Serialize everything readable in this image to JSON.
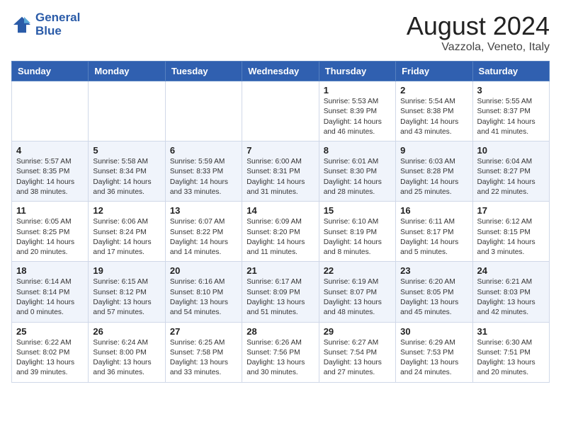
{
  "header": {
    "logo_line1": "General",
    "logo_line2": "Blue",
    "month_year": "August 2024",
    "location": "Vazzola, Veneto, Italy"
  },
  "weekdays": [
    "Sunday",
    "Monday",
    "Tuesday",
    "Wednesday",
    "Thursday",
    "Friday",
    "Saturday"
  ],
  "weeks": [
    [
      {
        "day": "",
        "info": ""
      },
      {
        "day": "",
        "info": ""
      },
      {
        "day": "",
        "info": ""
      },
      {
        "day": "",
        "info": ""
      },
      {
        "day": "1",
        "info": "Sunrise: 5:53 AM\nSunset: 8:39 PM\nDaylight: 14 hours\nand 46 minutes."
      },
      {
        "day": "2",
        "info": "Sunrise: 5:54 AM\nSunset: 8:38 PM\nDaylight: 14 hours\nand 43 minutes."
      },
      {
        "day": "3",
        "info": "Sunrise: 5:55 AM\nSunset: 8:37 PM\nDaylight: 14 hours\nand 41 minutes."
      }
    ],
    [
      {
        "day": "4",
        "info": "Sunrise: 5:57 AM\nSunset: 8:35 PM\nDaylight: 14 hours\nand 38 minutes."
      },
      {
        "day": "5",
        "info": "Sunrise: 5:58 AM\nSunset: 8:34 PM\nDaylight: 14 hours\nand 36 minutes."
      },
      {
        "day": "6",
        "info": "Sunrise: 5:59 AM\nSunset: 8:33 PM\nDaylight: 14 hours\nand 33 minutes."
      },
      {
        "day": "7",
        "info": "Sunrise: 6:00 AM\nSunset: 8:31 PM\nDaylight: 14 hours\nand 31 minutes."
      },
      {
        "day": "8",
        "info": "Sunrise: 6:01 AM\nSunset: 8:30 PM\nDaylight: 14 hours\nand 28 minutes."
      },
      {
        "day": "9",
        "info": "Sunrise: 6:03 AM\nSunset: 8:28 PM\nDaylight: 14 hours\nand 25 minutes."
      },
      {
        "day": "10",
        "info": "Sunrise: 6:04 AM\nSunset: 8:27 PM\nDaylight: 14 hours\nand 22 minutes."
      }
    ],
    [
      {
        "day": "11",
        "info": "Sunrise: 6:05 AM\nSunset: 8:25 PM\nDaylight: 14 hours\nand 20 minutes."
      },
      {
        "day": "12",
        "info": "Sunrise: 6:06 AM\nSunset: 8:24 PM\nDaylight: 14 hours\nand 17 minutes."
      },
      {
        "day": "13",
        "info": "Sunrise: 6:07 AM\nSunset: 8:22 PM\nDaylight: 14 hours\nand 14 minutes."
      },
      {
        "day": "14",
        "info": "Sunrise: 6:09 AM\nSunset: 8:20 PM\nDaylight: 14 hours\nand 11 minutes."
      },
      {
        "day": "15",
        "info": "Sunrise: 6:10 AM\nSunset: 8:19 PM\nDaylight: 14 hours\nand 8 minutes."
      },
      {
        "day": "16",
        "info": "Sunrise: 6:11 AM\nSunset: 8:17 PM\nDaylight: 14 hours\nand 5 minutes."
      },
      {
        "day": "17",
        "info": "Sunrise: 6:12 AM\nSunset: 8:15 PM\nDaylight: 14 hours\nand 3 minutes."
      }
    ],
    [
      {
        "day": "18",
        "info": "Sunrise: 6:14 AM\nSunset: 8:14 PM\nDaylight: 14 hours\nand 0 minutes."
      },
      {
        "day": "19",
        "info": "Sunrise: 6:15 AM\nSunset: 8:12 PM\nDaylight: 13 hours\nand 57 minutes."
      },
      {
        "day": "20",
        "info": "Sunrise: 6:16 AM\nSunset: 8:10 PM\nDaylight: 13 hours\nand 54 minutes."
      },
      {
        "day": "21",
        "info": "Sunrise: 6:17 AM\nSunset: 8:09 PM\nDaylight: 13 hours\nand 51 minutes."
      },
      {
        "day": "22",
        "info": "Sunrise: 6:19 AM\nSunset: 8:07 PM\nDaylight: 13 hours\nand 48 minutes."
      },
      {
        "day": "23",
        "info": "Sunrise: 6:20 AM\nSunset: 8:05 PM\nDaylight: 13 hours\nand 45 minutes."
      },
      {
        "day": "24",
        "info": "Sunrise: 6:21 AM\nSunset: 8:03 PM\nDaylight: 13 hours\nand 42 minutes."
      }
    ],
    [
      {
        "day": "25",
        "info": "Sunrise: 6:22 AM\nSunset: 8:02 PM\nDaylight: 13 hours\nand 39 minutes."
      },
      {
        "day": "26",
        "info": "Sunrise: 6:24 AM\nSunset: 8:00 PM\nDaylight: 13 hours\nand 36 minutes."
      },
      {
        "day": "27",
        "info": "Sunrise: 6:25 AM\nSunset: 7:58 PM\nDaylight: 13 hours\nand 33 minutes."
      },
      {
        "day": "28",
        "info": "Sunrise: 6:26 AM\nSunset: 7:56 PM\nDaylight: 13 hours\nand 30 minutes."
      },
      {
        "day": "29",
        "info": "Sunrise: 6:27 AM\nSunset: 7:54 PM\nDaylight: 13 hours\nand 27 minutes."
      },
      {
        "day": "30",
        "info": "Sunrise: 6:29 AM\nSunset: 7:53 PM\nDaylight: 13 hours\nand 24 minutes."
      },
      {
        "day": "31",
        "info": "Sunrise: 6:30 AM\nSunset: 7:51 PM\nDaylight: 13 hours\nand 20 minutes."
      }
    ]
  ]
}
